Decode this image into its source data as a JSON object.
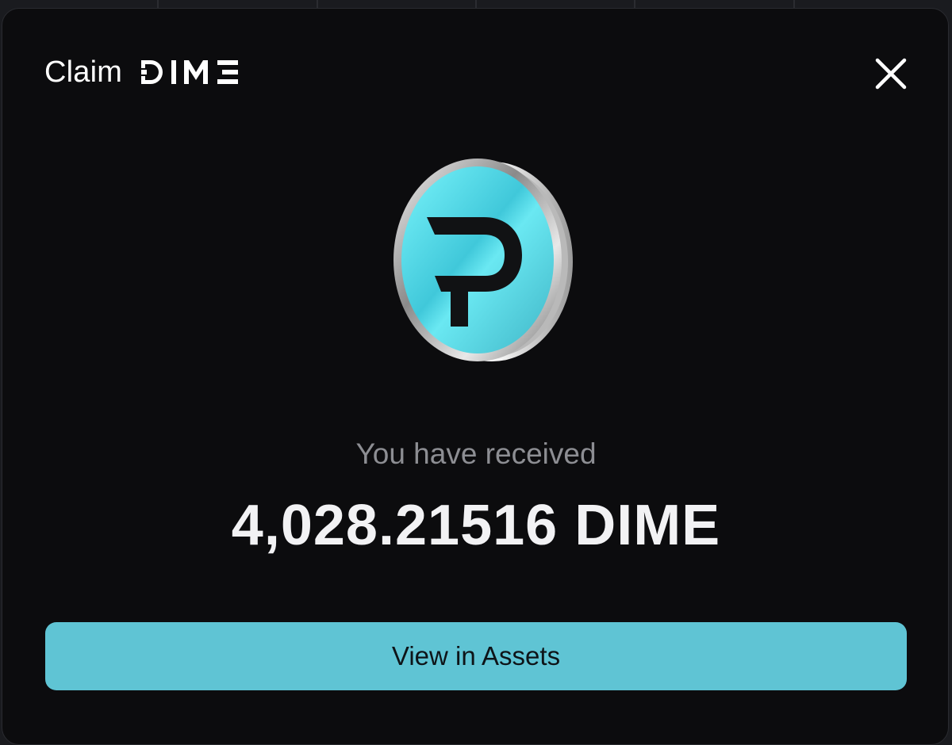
{
  "modal": {
    "title": "Claim",
    "brand": "DIME",
    "close_icon": "close-icon",
    "coin_icon": "dime-coin-icon"
  },
  "result": {
    "label": "You have received",
    "amount": "4,028.21516 DIME"
  },
  "actions": {
    "view_assets_label": "View in Assets"
  },
  "colors": {
    "modal_bg": "#0c0c0e",
    "accent": "#5fc4d4",
    "coin_face": "#5ee8f0",
    "muted_text": "#8d8e93"
  }
}
